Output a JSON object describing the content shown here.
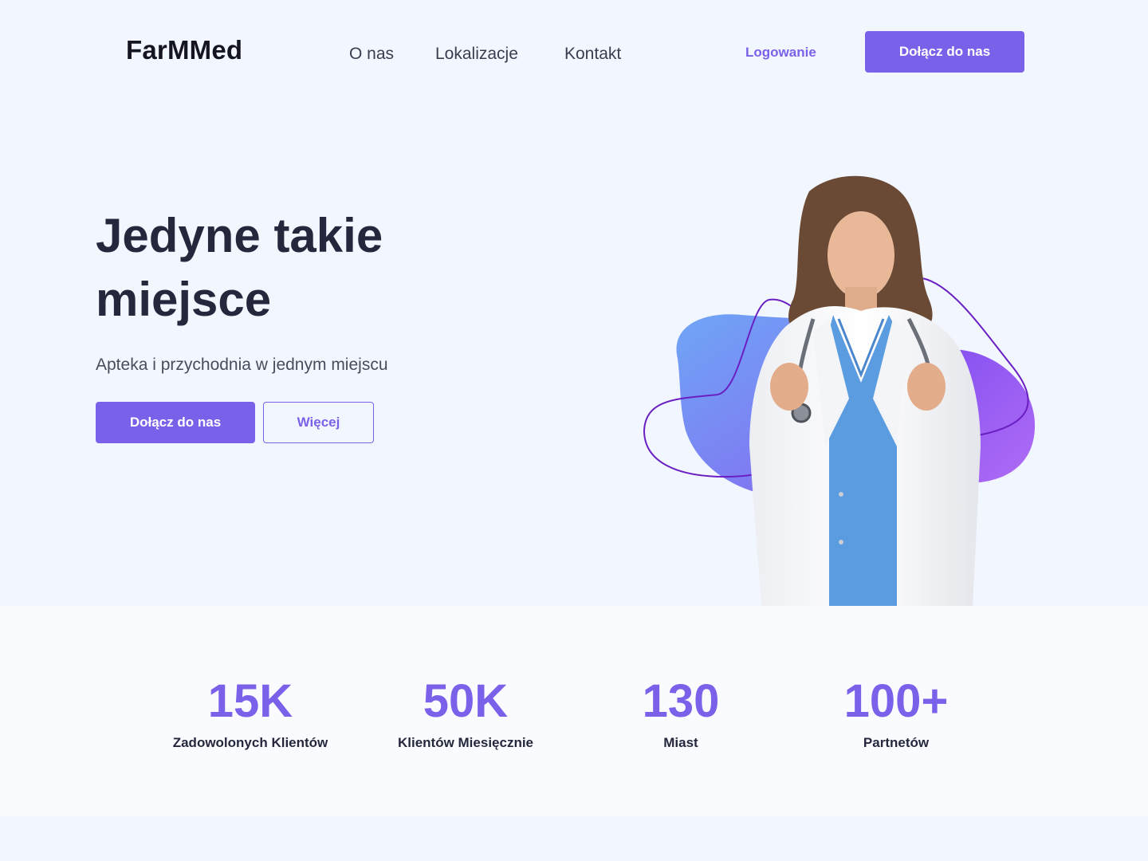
{
  "nav": {
    "logo": "FarMMed",
    "links": [
      "O nas",
      "Lokalizacje",
      "Kontakt"
    ],
    "login": "Logowanie",
    "cta": "Dołącz do nas"
  },
  "hero": {
    "title": "Jedyne takie miejsce",
    "subtitle": "Apteka i przychodnia w jednym miejscu",
    "cta_primary": "Dołącz do nas",
    "cta_secondary": "Więcej"
  },
  "stats": [
    {
      "value": "15K",
      "label": "Zadowolonych Klientów"
    },
    {
      "value": "50K",
      "label": "Klientów Miesięcznie"
    },
    {
      "value": "130",
      "label": "Miast"
    },
    {
      "value": "100+",
      "label": "Partnetów"
    }
  ],
  "colors": {
    "accent": "#7b61ea",
    "background": "#f2f6fe",
    "text": "#25283d"
  }
}
